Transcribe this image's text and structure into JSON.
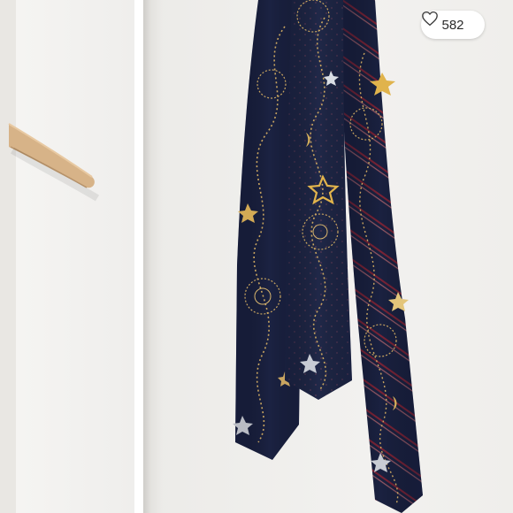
{
  "photo": {
    "left_panel_name": "hanger-photo",
    "right_panel_name": "ties-photo"
  },
  "like_button": {
    "count": "582",
    "icon": "heart-icon"
  },
  "colors": {
    "tie_navy": "#1b2240",
    "tie_mid": "#232c4a",
    "tie_stripe_red": "#8a2a3a",
    "embroidery_gold": "#c9a560",
    "hanger_wood": "#d9b58a"
  }
}
